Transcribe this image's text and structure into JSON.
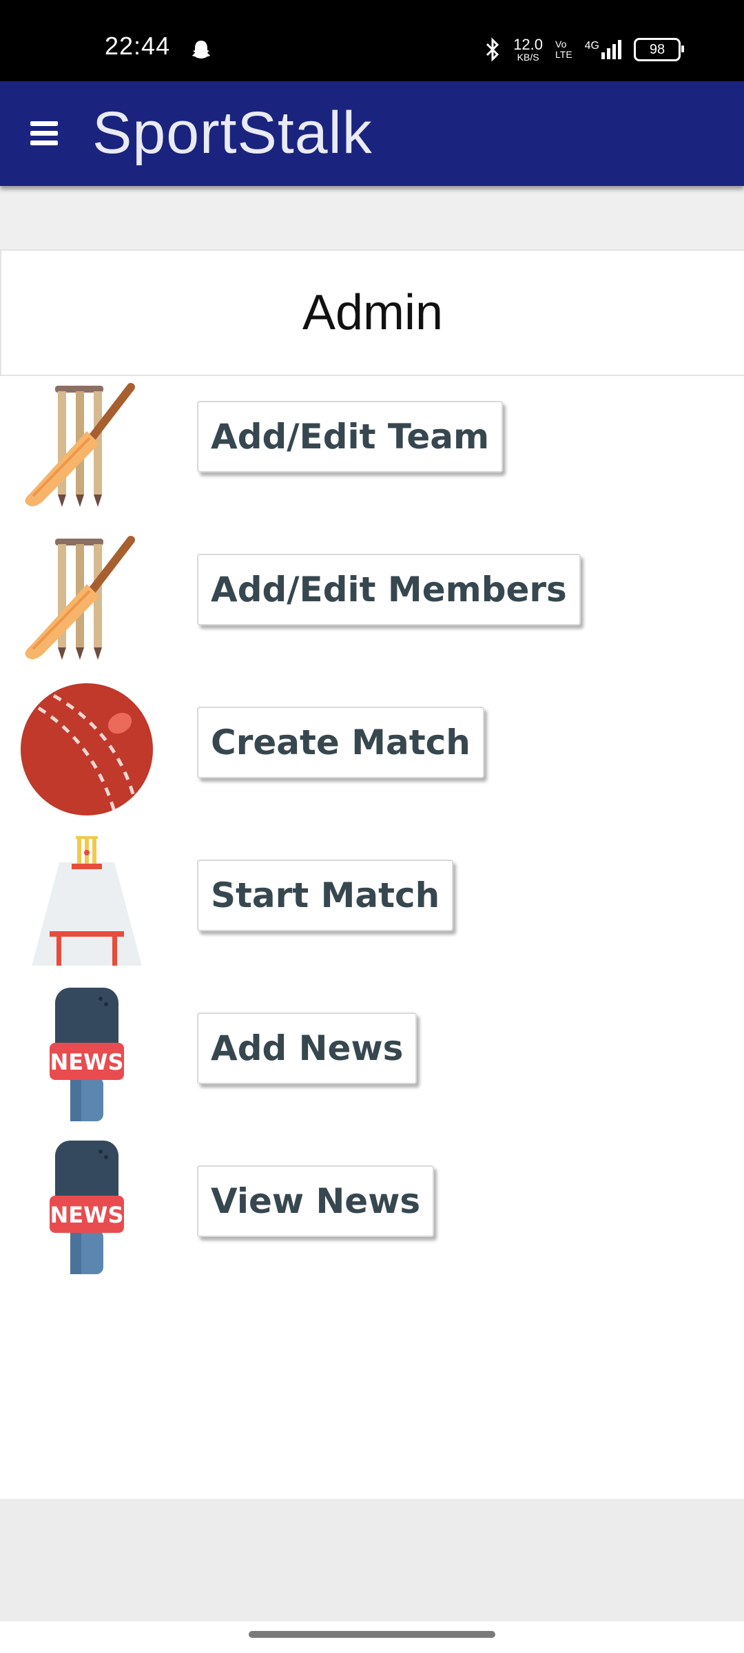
{
  "status_bar": {
    "time": "22:44",
    "net_speed_value": "12.0",
    "net_speed_unit": "KB/S",
    "volte_top": "Vo",
    "volte_bottom": "LTE",
    "network": "4G",
    "battery": "98"
  },
  "app_bar": {
    "title": "SportStalk",
    "menu_icon": "hamburger-menu-icon"
  },
  "page": {
    "title": "Admin"
  },
  "menu": [
    {
      "label": "Add/Edit Team",
      "icon": "cricket-bat-wickets-icon"
    },
    {
      "label": "Add/Edit Members",
      "icon": "cricket-bat-wickets-icon"
    },
    {
      "label": "Create Match",
      "icon": "cricket-ball-icon"
    },
    {
      "label": "Start Match",
      "icon": "cricket-pitch-icon"
    },
    {
      "label": "Add News",
      "icon": "news-microphone-icon"
    },
    {
      "label": "View News",
      "icon": "news-microphone-icon"
    }
  ],
  "news_mic_label": "NEWS",
  "colors": {
    "app_bar": "#1a237e",
    "button_text": "#37474f",
    "ball_red": "#c0392b"
  }
}
